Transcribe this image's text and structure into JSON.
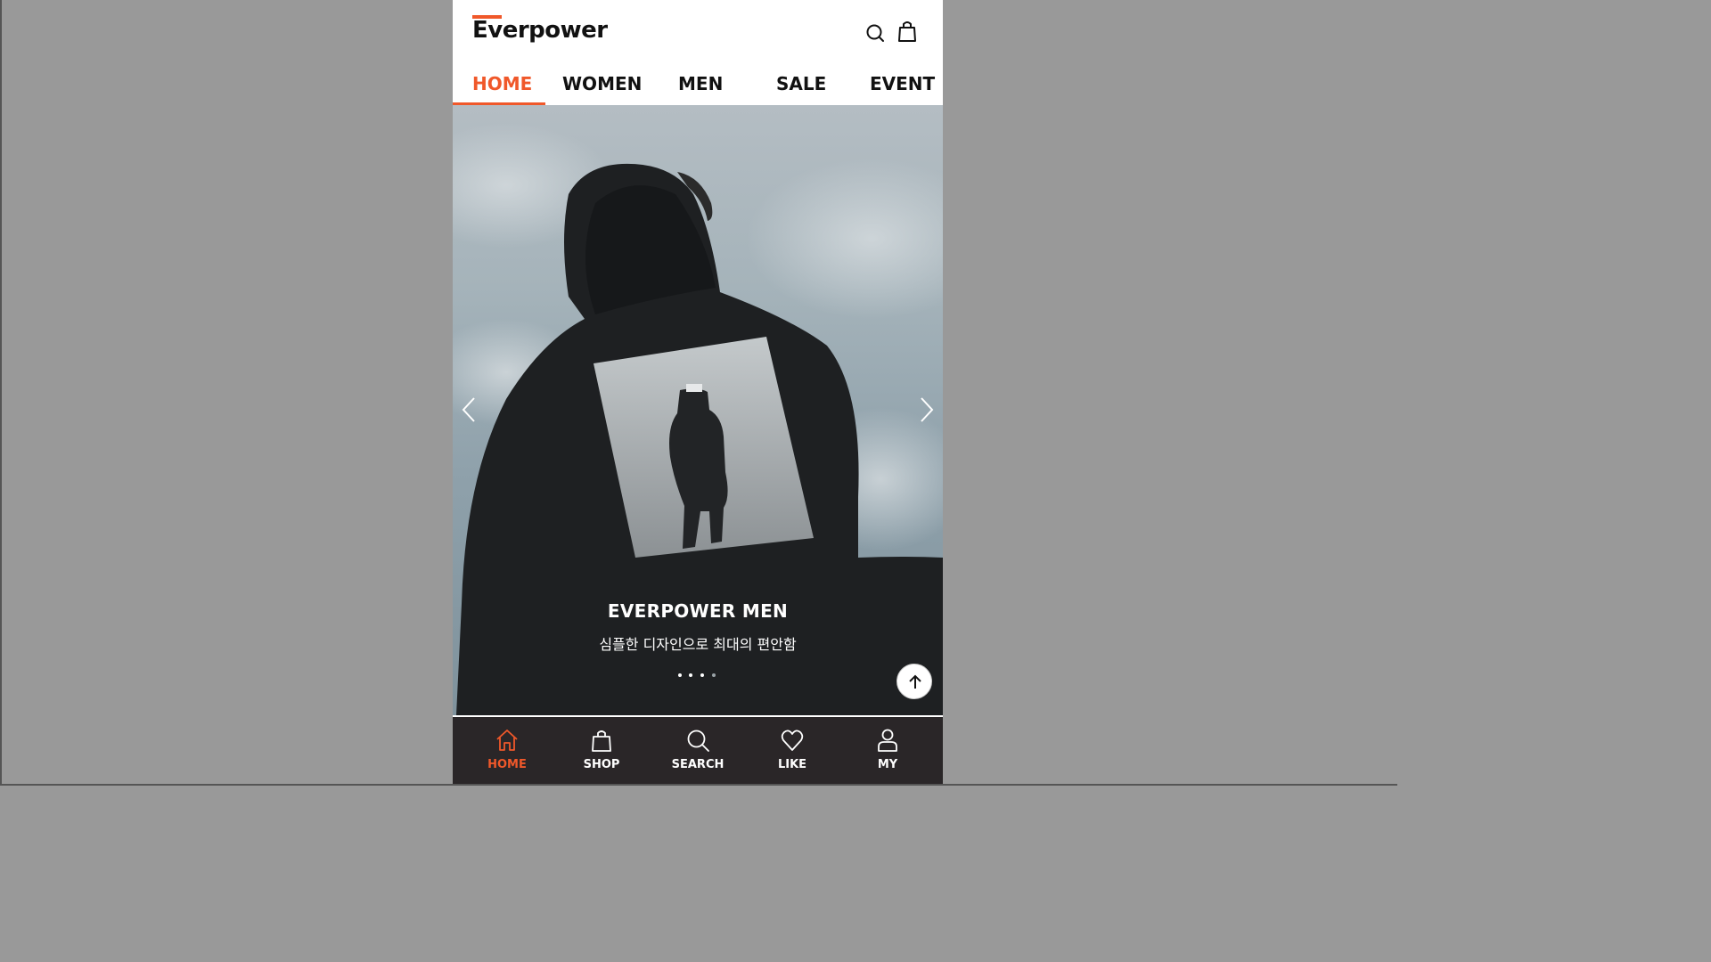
{
  "brand": {
    "name": "Everpower",
    "accent_color": "#f0582a"
  },
  "header": {
    "search_icon": "search-icon",
    "cart_icon": "shopping-bag-icon"
  },
  "top_nav": {
    "tabs": [
      {
        "label": "HOME",
        "active": true
      },
      {
        "label": "WOMEN",
        "active": false
      },
      {
        "label": "MEN",
        "active": false
      },
      {
        "label": "SALE",
        "active": false
      },
      {
        "label": "EVENT",
        "active": false
      }
    ]
  },
  "hero": {
    "title": "EVERPOWER MEN",
    "subtitle": "심플한 디자인으로 최대의 편안함",
    "slide_count": 4,
    "active_slide": 4,
    "prev_icon": "chevron-left-icon",
    "next_icon": "chevron-right-icon",
    "scroll_top_icon": "arrow-up-icon"
  },
  "bottom_nav": {
    "items": [
      {
        "label": "HOME",
        "icon": "home-icon",
        "active": true
      },
      {
        "label": "SHOP",
        "icon": "shopping-bag-icon",
        "active": false
      },
      {
        "label": "SEARCH",
        "icon": "search-icon",
        "active": false
      },
      {
        "label": "LIKE",
        "icon": "heart-icon",
        "active": false
      },
      {
        "label": "MY",
        "icon": "user-icon",
        "active": false
      }
    ],
    "background_color": "#2a2628"
  }
}
